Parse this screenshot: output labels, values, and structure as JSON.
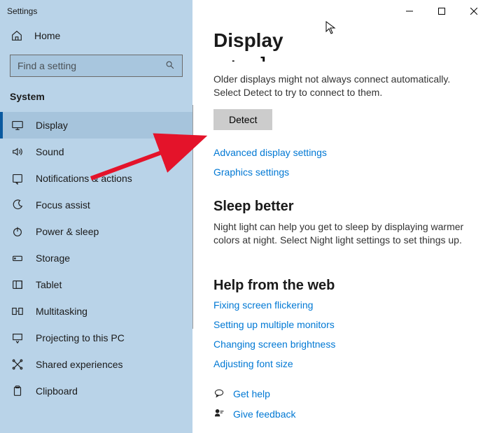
{
  "window": {
    "title": "Settings"
  },
  "sidebar": {
    "home": "Home",
    "search_placeholder": "Find a setting",
    "category": "System",
    "items": [
      {
        "label": "Display",
        "icon": "display-icon",
        "selected": true
      },
      {
        "label": "Sound",
        "icon": "sound-icon"
      },
      {
        "label": "Notifications & actions",
        "icon": "notifications-icon"
      },
      {
        "label": "Focus assist",
        "icon": "moon-icon"
      },
      {
        "label": "Power & sleep",
        "icon": "power-icon"
      },
      {
        "label": "Storage",
        "icon": "storage-icon"
      },
      {
        "label": "Tablet",
        "icon": "tablet-icon"
      },
      {
        "label": "Multitasking",
        "icon": "multitasking-icon"
      },
      {
        "label": "Projecting to this PC",
        "icon": "projecting-icon"
      },
      {
        "label": "Shared experiences",
        "icon": "shared-icon"
      },
      {
        "label": "Clipboard",
        "icon": "clipboard-icon"
      }
    ]
  },
  "main": {
    "title": "Display",
    "detect_desc": "Older displays might not always connect automatically. Select Detect to try to connect to them.",
    "detect_btn": "Detect",
    "adv_link": "Advanced display settings",
    "gfx_link": "Graphics settings",
    "sleep_h": "Sleep better",
    "sleep_desc": "Night light can help you get to sleep by displaying warmer colors at night. Select Night light settings to set things up.",
    "help_h": "Help from the web",
    "help_links": [
      "Fixing screen flickering",
      "Setting up multiple monitors",
      "Changing screen brightness",
      "Adjusting font size"
    ],
    "get_help": "Get help",
    "feedback": "Give feedback"
  }
}
